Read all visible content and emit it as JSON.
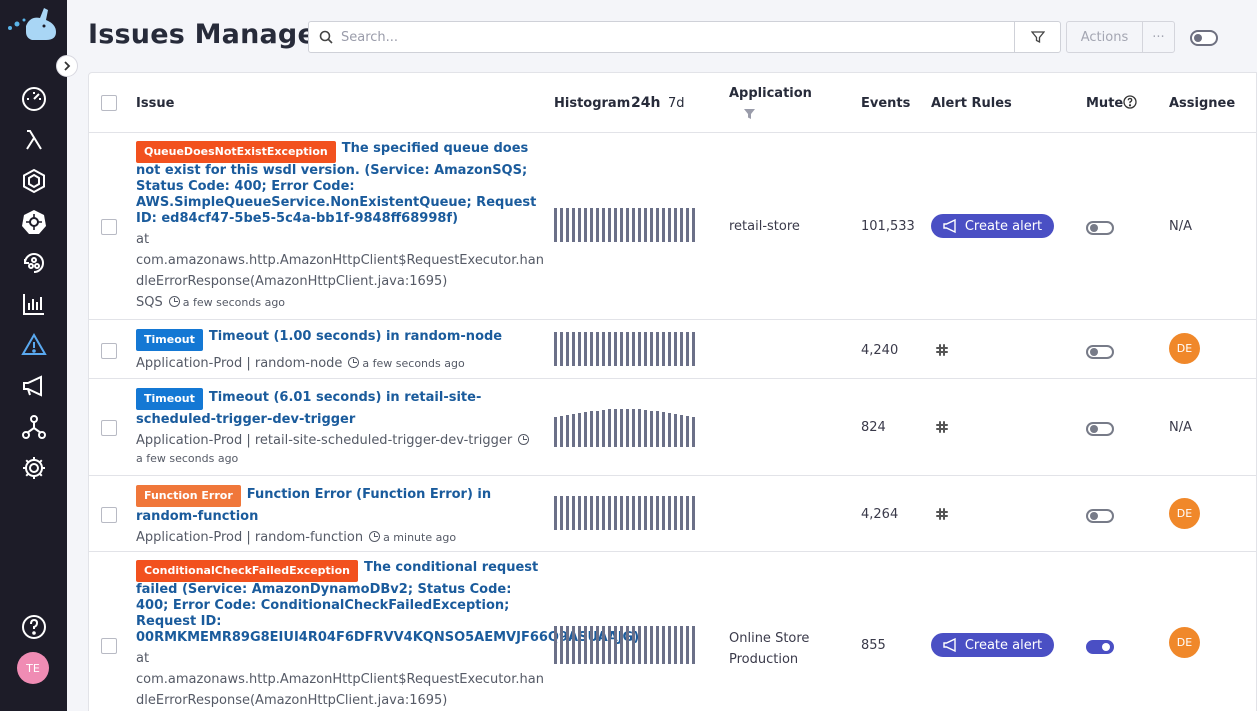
{
  "page": {
    "title": "Issues Manager"
  },
  "search": {
    "placeholder": "Search..."
  },
  "toolbar": {
    "actions_label": "Actions",
    "more_label": "···"
  },
  "sidebar": {
    "user_initials": "TE"
  },
  "table": {
    "headers": {
      "issue": "Issue",
      "histogram": "Histogram",
      "range_24h": "24h",
      "range_7d": "7d",
      "application": "Application",
      "events": "Events",
      "alert_rules": "Alert Rules",
      "mute": "Mute",
      "assignee": "Assignee"
    },
    "create_alert_label": "Create alert",
    "rows": [
      {
        "badge": "QueueDoesNotExistException",
        "badge_color": "#f2511e",
        "title": "The specified queue does not exist for this wsdl version. (Service: AmazonSQS; Status Code: 400; Error Code: AWS.SimpleQueueService.NonExistentQueue; Request ID: ed84cf47-5be5-5c4a-bb1f-9848ff68998f)",
        "detail_1": "at",
        "detail_2": "com.amazonaws.http.AmazonHttpClient$RequestExecutor.han",
        "detail_3": "dleErrorResponse(AmazonHttpClient.java:1695)",
        "source": "SQS",
        "time": "a few seconds ago",
        "application": "retail-store",
        "events": "101,533",
        "alert": "create",
        "muted": false,
        "assignee": "N/A"
      },
      {
        "badge": "Timeout",
        "badge_color": "#1478d4",
        "title": "Timeout (1.00 seconds) in random-node",
        "source": "Application-Prod | random-node",
        "time": "a few seconds ago",
        "application": "",
        "events": "4,240",
        "alert": "slack",
        "muted": false,
        "assignee": "DE"
      },
      {
        "badge": "Timeout",
        "badge_color": "#1478d4",
        "title": "Timeout (6.01 seconds) in retail-site-scheduled-trigger-dev-trigger",
        "source": "Application-Prod | retail-site-scheduled-trigger-dev-trigger",
        "time": "a few seconds ago",
        "application": "",
        "events": "824",
        "alert": "slack",
        "muted": false,
        "assignee": "N/A"
      },
      {
        "badge": "Function Error",
        "badge_color": "#f0773a",
        "title": "Function Error (Function Error) in random-function",
        "source": "Application-Prod | random-function",
        "time": "a minute ago",
        "application": "",
        "events": "4,264",
        "alert": "slack",
        "muted": false,
        "assignee": "DE"
      },
      {
        "badge": "ConditionalCheckFailedException",
        "badge_color": "#f2511e",
        "title": "The conditional request failed (Service: AmazonDynamoDBv2; Status Code: 400; Error Code: ConditionalCheckFailedException; Request ID: 00RMKMEMR89G8EIUI4R04F6DFRVV4KQNSO5AEMVJF66Q9ASUAAJG)",
        "detail_1": "at",
        "detail_2": "com.amazonaws.http.AmazonHttpClient$RequestExecutor.han",
        "detail_3": "dleErrorResponse(AmazonHttpClient.java:1695)",
        "application": "Online Store Production",
        "events": "855",
        "alert": "create",
        "muted": true,
        "assignee": "DE"
      }
    ]
  }
}
